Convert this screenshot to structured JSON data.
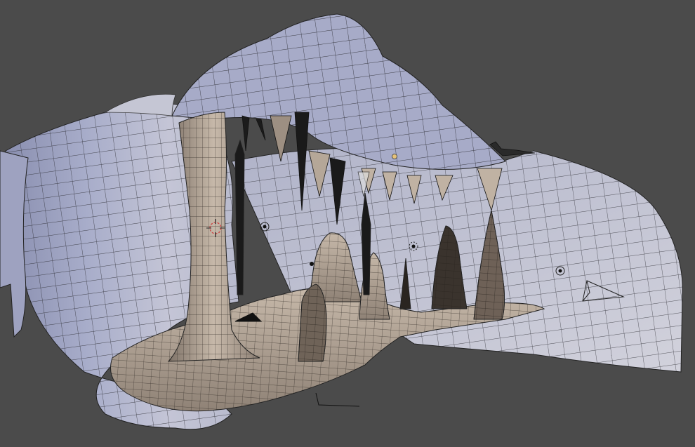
{
  "viewport": {
    "mode": "3d-view-wireframe-solid",
    "background_color": "#4b4b4b",
    "shell_color": "#a9aec8",
    "shell_shadow": "#8c90ad",
    "shell_highlight": "#c9cad8",
    "rock_color": "#b9ab9d",
    "rock_shadow": "#8a7c70",
    "wire_color": "#1a1a1a",
    "icons": {
      "cursor": "3d-cursor-icon",
      "lamp": "lamp-icon",
      "camera": "camera-icon",
      "empty": "empty-object-icon"
    }
  }
}
